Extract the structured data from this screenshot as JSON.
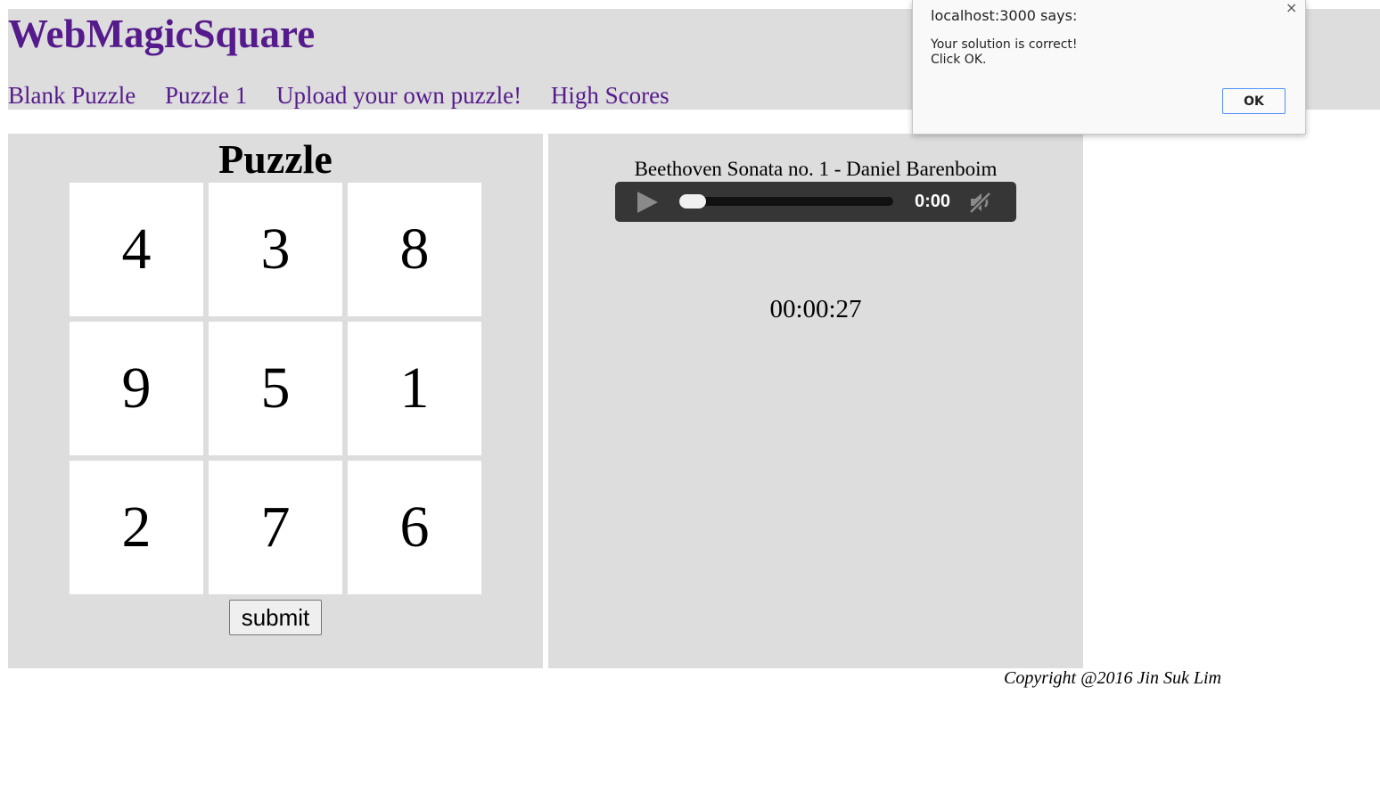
{
  "header": {
    "site_title": "WebMagicSquare",
    "nav": [
      "Blank Puzzle",
      "Puzzle 1",
      "Upload your own puzzle!",
      "High Scores"
    ]
  },
  "puzzle": {
    "title": "Puzzle",
    "cells": [
      "4",
      "3",
      "8",
      "9",
      "5",
      "1",
      "2",
      "7",
      "6"
    ],
    "submit_label": "submit"
  },
  "media": {
    "track_title": "Beethoven Sonata no. 1 - Daniel Barenboim",
    "player": {
      "time": "0:00",
      "progress": 0,
      "muted": true,
      "play_icon": "play-icon",
      "mute_icon": "muted-speaker-icon"
    },
    "timer": "00:00:27"
  },
  "footer": {
    "copyright": "Copyright @2016 Jin Suk Lim"
  },
  "dialog": {
    "title": "localhost:3000 says:",
    "message_line1": "Your solution is correct!",
    "message_line2": "Click OK.",
    "ok_label": "OK",
    "close_glyph": "×"
  },
  "colors": {
    "link": "#551a8b",
    "panel_bg": "#dddddd",
    "player_bg": "#363636"
  }
}
